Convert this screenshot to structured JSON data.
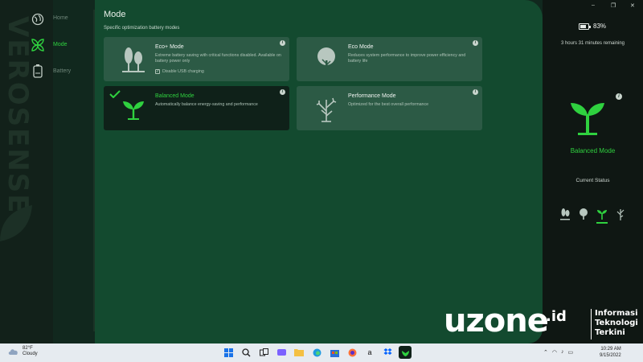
{
  "nav": {
    "brand": "VEROSENSE",
    "items": [
      {
        "label": "Home",
        "icon": "globe-icon"
      },
      {
        "label": "Mode",
        "icon": "leaves-icon",
        "active": true
      },
      {
        "label": "Battery",
        "icon": "battery-icon"
      }
    ]
  },
  "main": {
    "title": "Mode",
    "subtitle": "Specific optimization battery modes",
    "modes": [
      {
        "name": "Eco+ Mode",
        "desc": "Extreme battery saving with critical functions disabled. Available on battery power only",
        "option": "Disable USB charging",
        "option_checked": true,
        "icon": "two-trees-icon"
      },
      {
        "name": "Eco Mode",
        "desc": "Reduces system performance to improve power efficiency and battery life",
        "icon": "tree-icon"
      },
      {
        "name": "Balanced Mode",
        "desc": "Automatically balance energy-saving and performance",
        "icon": "sprout-icon",
        "selected": true
      },
      {
        "name": "Performance Mode",
        "desc": "Optimized for the best overall performance",
        "icon": "bare-branch-icon"
      }
    ]
  },
  "status": {
    "battery_pct": "83%",
    "battery_level": 0.83,
    "remaining": "3 hours 31 minutes remaining",
    "current_mode": "Balanced Mode",
    "current_status_label": "Current Status",
    "window_buttons": [
      "–",
      "❐",
      "✕"
    ]
  },
  "watermark": {
    "brand": "uzone",
    "suffix": ".id",
    "tagline": [
      "Informasi",
      "Teknologi",
      "Terkini"
    ]
  },
  "taskbar": {
    "temp": "82°F",
    "condition": "Cloudy",
    "time": "10:29 AM",
    "date": "9/15/2022",
    "colors": {
      "accent": "#2fd13f",
      "bg": "#e6ebf0"
    }
  }
}
